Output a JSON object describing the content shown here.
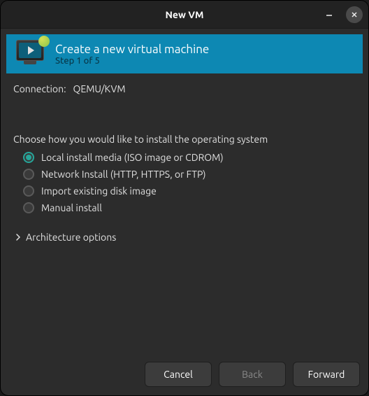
{
  "window": {
    "title": "New VM"
  },
  "header": {
    "title": "Create a new virtual machine",
    "step": "Step 1 of 5"
  },
  "connection": {
    "label": "Connection:",
    "value": "QEMU/KVM"
  },
  "install": {
    "prompt": "Choose how you would like to install the operating system",
    "options": [
      {
        "label": "Local install media (ISO image or CDROM)",
        "selected": true
      },
      {
        "label": "Network Install (HTTP, HTTPS, or FTP)",
        "selected": false
      },
      {
        "label": "Import existing disk image",
        "selected": false
      },
      {
        "label": "Manual install",
        "selected": false
      }
    ]
  },
  "expander": {
    "label": "Architecture options"
  },
  "footer": {
    "cancel": "Cancel",
    "back": "Back",
    "forward": "Forward"
  }
}
